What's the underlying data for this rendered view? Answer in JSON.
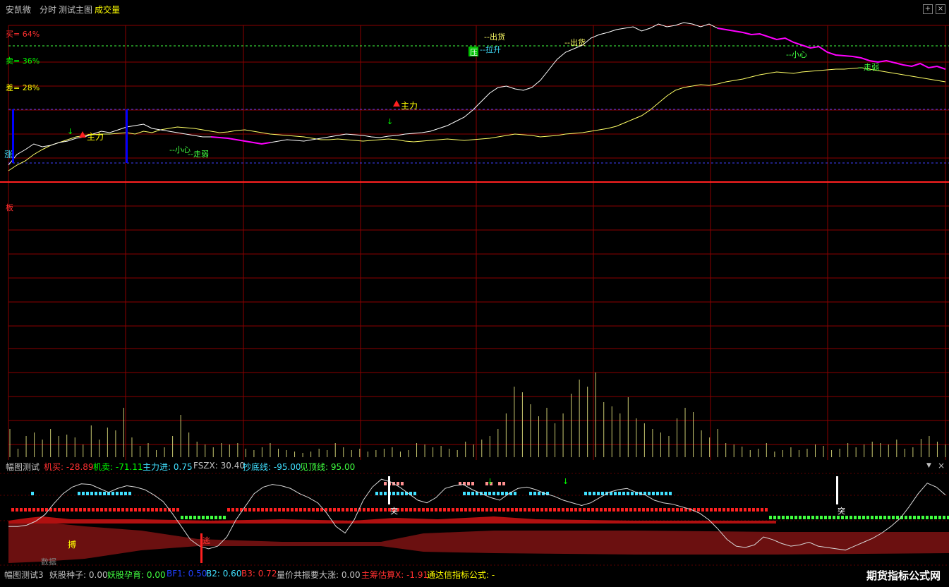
{
  "title_bar": {
    "stock_name": "安凯微",
    "mode": "分时",
    "main_indicator": "测试主图",
    "volume_label": "成交量",
    "colors": {
      "text": "#c0c0c0",
      "accent": "#ffff00"
    }
  },
  "main_chart": {
    "labels": {
      "buy": "买= 64%",
      "sell": "卖= 36%",
      "diff": "差= 28%",
      "zhang": "涨",
      "ban": "板"
    },
    "signals": {
      "zhuli_1": "主力",
      "zhuli_2": "主力",
      "xiaoxin_1": "--小心",
      "zouruo_1": "--走弱",
      "ya": "压",
      "lasheng": "--拉升",
      "chuhuo_1": "--出货",
      "chuhuo_2": "--出货",
      "xiaoxin_2": "--小心",
      "zouruo_2": "--走弱"
    },
    "colors": {
      "price": "#ffffff",
      "avg": "#ffff66",
      "weak": "#ff00ff",
      "grid": "#8b0000"
    }
  },
  "chart_data": [
    {
      "type": "line",
      "title": "",
      "series": [
        {
          "name": "",
          "values": [
            22,
            30,
            36,
            45,
            52,
            58,
            62,
            66,
            70,
            72,
            73,
            74,
            74,
            75,
            76,
            74,
            78,
            76,
            80,
            82,
            84,
            83,
            82,
            80,
            78,
            76,
            77,
            79,
            80,
            78,
            76,
            74,
            73,
            72,
            71,
            70,
            68,
            66,
            66,
            67,
            66,
            65,
            64,
            65,
            66,
            67,
            66,
            64,
            63,
            64,
            65,
            66,
            67,
            66,
            65,
            66,
            67,
            68,
            70,
            72,
            74,
            73,
            72,
            70,
            71,
            72,
            74,
            75,
            76,
            78,
            80,
            82,
            85,
            90,
            95,
            100,
            108,
            118,
            128,
            136,
            140,
            142,
            144,
            143,
            145,
            148,
            150,
            152,
            155,
            158,
            160,
            162,
            161,
            160,
            162,
            163,
            164,
            165,
            166,
            166,
            167,
            168,
            166,
            164,
            162,
            160,
            158,
            156,
            154,
            152,
            150,
            148
          ]
        },
        {
          "name": "",
          "values": [
            30,
            45,
            52,
            60,
            56,
            58,
            62,
            64,
            68,
            70,
            74,
            78,
            76,
            80,
            84,
            86,
            88,
            82,
            80,
            78,
            76,
            74,
            72,
            70,
            70,
            69,
            68,
            66,
            64,
            62,
            60,
            62,
            64,
            66,
            65,
            64,
            66,
            68,
            70,
            72,
            74,
            73,
            72,
            70,
            69,
            71,
            72,
            74,
            75,
            76,
            78,
            82,
            86,
            92,
            98,
            108,
            120,
            132,
            140,
            142,
            138,
            136,
            140,
            150,
            165,
            180,
            190,
            195,
            200,
            210,
            215,
            218,
            222,
            224,
            226,
            220,
            224,
            230,
            226,
            228,
            232,
            230,
            226,
            230,
            224,
            222,
            220,
            218,
            215,
            216,
            212,
            208,
            210,
            204,
            200,
            196,
            198,
            190,
            186,
            185,
            184,
            182,
            178,
            176,
            178,
            175,
            172,
            170,
            174,
            168,
            170,
            166
          ]
        }
      ],
      "ylim": [
        0,
        260
      ]
    },
    {
      "type": "bar",
      "title": "",
      "values": [
        40,
        12,
        30,
        35,
        25,
        40,
        30,
        32,
        28,
        18,
        45,
        25,
        42,
        38,
        70,
        28,
        16,
        20,
        10,
        14,
        30,
        60,
        35,
        22,
        18,
        14,
        20,
        18,
        20,
        12,
        10,
        14,
        20,
        12,
        10,
        8,
        6,
        8,
        12,
        10,
        20,
        14,
        10,
        12,
        8,
        10,
        12,
        14,
        8,
        10,
        20,
        18,
        14,
        16,
        12,
        10,
        22,
        18,
        25,
        30,
        40,
        62,
        100,
        92,
        75,
        58,
        70,
        48,
        62,
        90,
        110,
        100,
        120,
        78,
        72,
        62,
        85,
        55,
        48,
        40,
        35,
        30,
        55,
        70,
        64,
        38,
        28,
        40,
        20,
        18,
        15,
        10,
        12,
        20,
        8,
        10,
        14,
        10,
        12,
        18,
        16,
        10,
        12,
        20,
        14,
        18,
        22,
        20,
        18,
        25,
        12,
        14,
        26,
        30,
        22,
        18
      ],
      "ylim": [
        0,
        150
      ]
    },
    {
      "type": "line",
      "title": "",
      "series": [
        {
          "name": "",
          "values": [
            60,
            60,
            62,
            68,
            78,
            95,
            110,
            120,
            125,
            124,
            118,
            112,
            118,
            122,
            120,
            116,
            108,
            98,
            80,
            60,
            40,
            30,
            26,
            30,
            44,
            70,
            90,
            110,
            120,
            124,
            122,
            118,
            110,
            104,
            96,
            80,
            60,
            50,
            70,
            100,
            120,
            132,
            128,
            120,
            110,
            100,
            96,
            104,
            118,
            122,
            124,
            116,
            110,
            104,
            100,
            110,
            118,
            120,
            116,
            110,
            106,
            100,
            96,
            92,
            96,
            104,
            112,
            116,
            118,
            112,
            108,
            100,
            96,
            94,
            90,
            86,
            80,
            70,
            56,
            40,
            30,
            28,
            32,
            44,
            40,
            34,
            30,
            32,
            36,
            30,
            28,
            26,
            24,
            30,
            36,
            42,
            50,
            60,
            72,
            90,
            110,
            126,
            120,
            108
          ]
        }
      ],
      "ylim": [
        0,
        140
      ]
    }
  ],
  "indicator_panel": {
    "name": "幅图测试",
    "values": [
      {
        "label": "机买",
        "value": "-28.89"
      },
      {
        "label": "机卖",
        "value": "-71.11"
      },
      {
        "label": "主力进",
        "value": "0.75"
      },
      {
        "label": "FSZX",
        "value": "30.40"
      },
      {
        "label": "抄底线",
        "value": "-95.00"
      },
      {
        "label": "见顶线",
        "value": "95.00"
      }
    ],
    "signals": {
      "tu_1": "突",
      "tu_2": "突",
      "bo": "搏",
      "tao": "逃"
    },
    "no_data": "数据",
    "colors": {
      "buy": "#ff3030",
      "sell": "#00ff00",
      "cyan": "#40e0ff",
      "yellow": "#ffff00",
      "white": "#ffffff"
    }
  },
  "bottom_panel": {
    "name": "幅图测试3",
    "values": [
      {
        "label": "妖股种子",
        "value": "0.00"
      },
      {
        "label": "妖股孕育",
        "value": "0.00"
      },
      {
        "label": "BF1",
        "value": "0.50"
      },
      {
        "label": "B2",
        "value": "0.60"
      },
      {
        "label": "B3",
        "value": "0.72"
      },
      {
        "label": "量价共振要大涨",
        "value": "0.00"
      },
      {
        "label": "主筹估算X",
        "value": "-1.91"
      },
      {
        "label": "通达信指标公式",
        "value": "-"
      }
    ],
    "watermark": "期货指标公式网"
  }
}
